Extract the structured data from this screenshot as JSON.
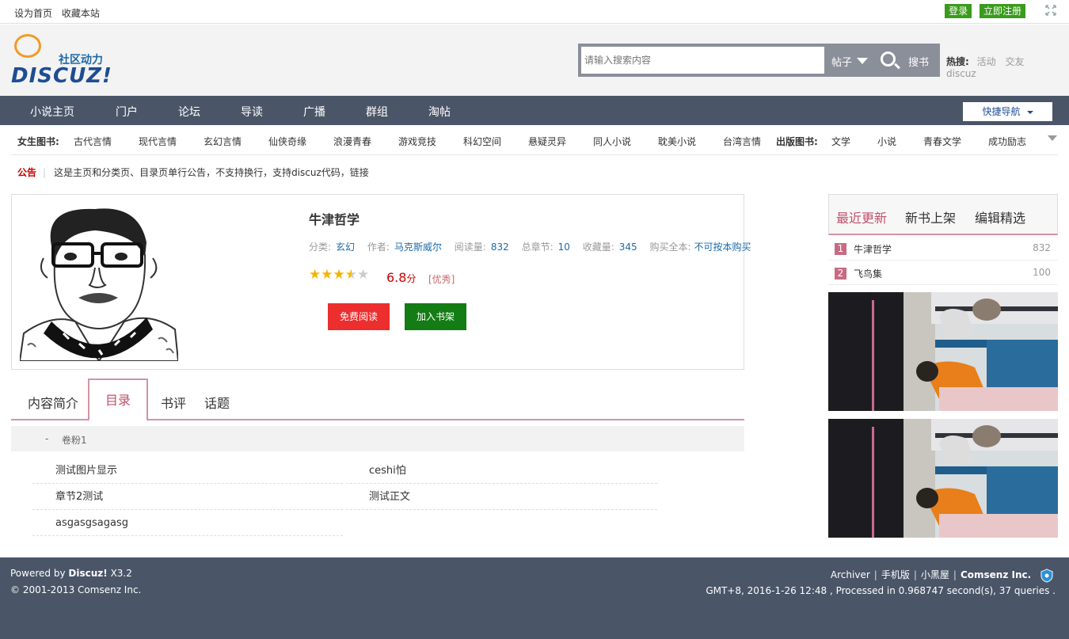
{
  "topbar": {
    "set_home": "设为首页",
    "bookmark": "收藏本站",
    "login": "登录",
    "register": "立即注册"
  },
  "logo": {
    "cn": "社区动力",
    "en": "DISCUZ!"
  },
  "search": {
    "placeholder": "请输入搜索内容",
    "type": "帖子",
    "button": "搜书"
  },
  "hot": {
    "label": "热搜:",
    "items": [
      "活动",
      "交友",
      "discuz"
    ]
  },
  "nav": {
    "items": [
      "小说主页",
      "门户",
      "论坛",
      "导读",
      "广播",
      "群组",
      "淘帖"
    ],
    "quick": "快捷导航"
  },
  "subnav": {
    "female_label": "女生图书:",
    "female": [
      "古代言情",
      "现代言情",
      "玄幻言情",
      "仙侠奇缘",
      "浪漫青春",
      "游戏竞技",
      "科幻空间",
      "悬疑灵异",
      "同人小说",
      "耽美小说",
      "台湾言情"
    ],
    "pub_label": "出版图书:",
    "pub": [
      "文学",
      "小说",
      "青春文学",
      "成功励志"
    ]
  },
  "notice": {
    "label": "公告",
    "text": "这是主页和分类页、目录页单行公告，不支持换行，支持discuz代码，链接"
  },
  "book": {
    "title": "牛津哲学",
    "category_label": "分类:",
    "category": "玄幻",
    "author_label": "作者:",
    "author": "马克斯威尔",
    "reads_label": "阅读量:",
    "reads": "832",
    "chapters_label": "总章节:",
    "chapters": "10",
    "favs_label": "收藏量:",
    "favs": "345",
    "buy_label": "购买全本:",
    "buy": "不可按本购买",
    "rating": 3.5,
    "score": "6.8",
    "score_unit": "分",
    "grade": "[优秀]",
    "read_btn": "免费阅读",
    "add_btn": "加入书架"
  },
  "tabs": [
    "内容简介",
    "目录",
    "书评",
    "话题"
  ],
  "toc": {
    "volume_marker": "-",
    "volume": "卷粉1",
    "chapters": [
      "测试图片显示",
      "ceshi怕",
      "章节2测试",
      "测试正文",
      "asgasgsagasg"
    ]
  },
  "side": {
    "tabs": [
      "最近更新",
      "新书上架",
      "编辑精选"
    ],
    "ranks": [
      {
        "n": "1",
        "title": "牛津哲学",
        "count": "832"
      },
      {
        "n": "2",
        "title": "飞鸟集",
        "count": "100"
      }
    ]
  },
  "footer": {
    "powered": "Powered by",
    "brand": "Discuz!",
    "version": "X3.2",
    "copyright": "© 2001-2013 Comsenz Inc.",
    "links": [
      "Archiver",
      "手机版",
      "小黑屋"
    ],
    "company": "Comsenz Inc.",
    "stats": "GMT+8, 2016-1-26 12:48 , Processed in 0.968747 second(s), 37 queries ."
  },
  "colors": {
    "nav_bg": "#4a5568",
    "accent_pink": "#d393a4",
    "login_green": "#3a9b1c",
    "read_red": "#ec2e2e",
    "add_green": "#147c14"
  }
}
